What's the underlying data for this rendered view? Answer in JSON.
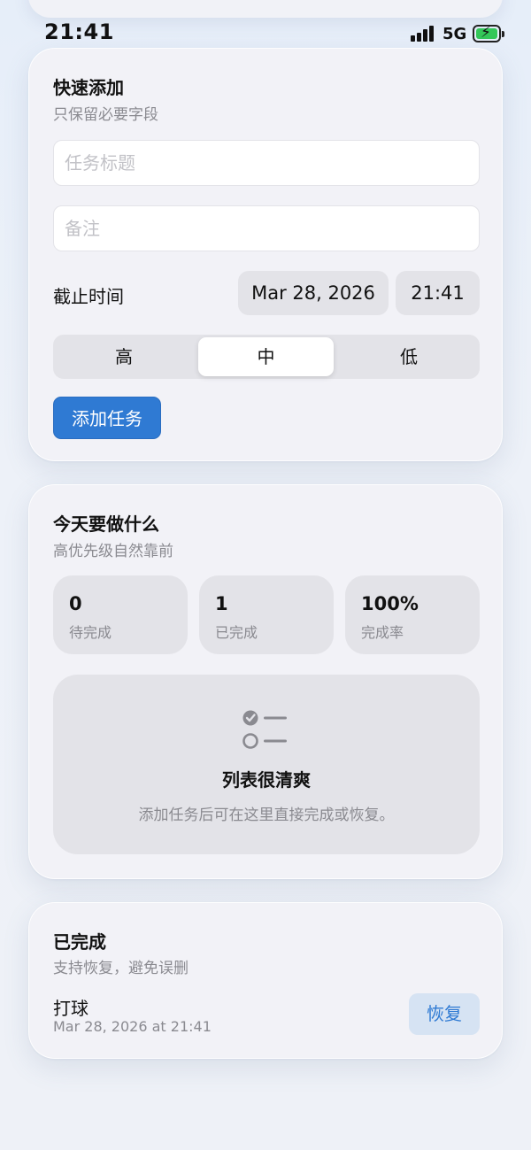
{
  "status_bar": {
    "time": "21:41",
    "network": "5G"
  },
  "quick_add": {
    "title": "快速添加",
    "subtitle": "只保留必要字段",
    "title_placeholder": "任务标题",
    "note_placeholder": "备注",
    "deadline_label": "截止时间",
    "date": "Mar 28, 2026",
    "time": "21:41",
    "priorities": [
      "高",
      "中",
      "低"
    ],
    "selected_priority": "中",
    "add_button": "添加任务",
    "accent_color": "#2f7ad3"
  },
  "today": {
    "title": "今天要做什么",
    "subtitle": "高优先级自然靠前",
    "stats": [
      {
        "value": "0",
        "label": "待完成"
      },
      {
        "value": "1",
        "label": "已完成"
      },
      {
        "value": "100%",
        "label": "完成率"
      }
    ],
    "empty_icon": "checklist-icon",
    "empty_title": "列表很清爽",
    "empty_desc": "添加任务后可在这里直接完成或恢复。"
  },
  "completed": {
    "title": "已完成",
    "subtitle": "支持恢复，避免误删",
    "items": [
      {
        "name": "打球",
        "time": "Mar 28, 2026 at 21:41",
        "action": "恢复"
      }
    ]
  }
}
